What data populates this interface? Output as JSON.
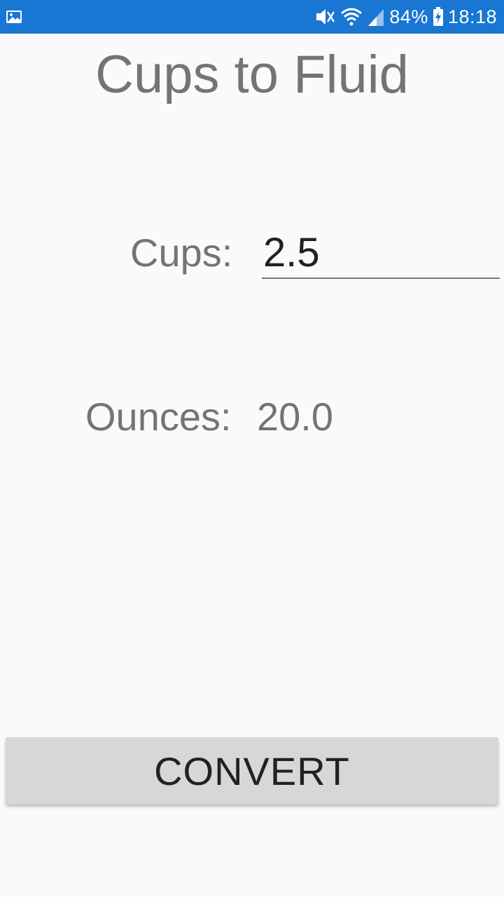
{
  "status_bar": {
    "battery_percent": "84%",
    "time": "18:18",
    "icons": [
      "image-notification-icon",
      "mute-vibrate-icon",
      "wifi-icon",
      "cell-signal-icon",
      "battery-charging-icon"
    ],
    "background_color": "#1976d2"
  },
  "app": {
    "title": "Cups to Fluid"
  },
  "form": {
    "cups_label": "Cups:",
    "cups_value": "2.5",
    "ounces_label": "Ounces:",
    "ounces_value": "20.0",
    "convert_label": "CONVERT"
  },
  "colors": {
    "label_text": "#747474",
    "input_text": "#212121",
    "button_bg": "#d6d7d7",
    "page_bg": "#fafafa"
  }
}
